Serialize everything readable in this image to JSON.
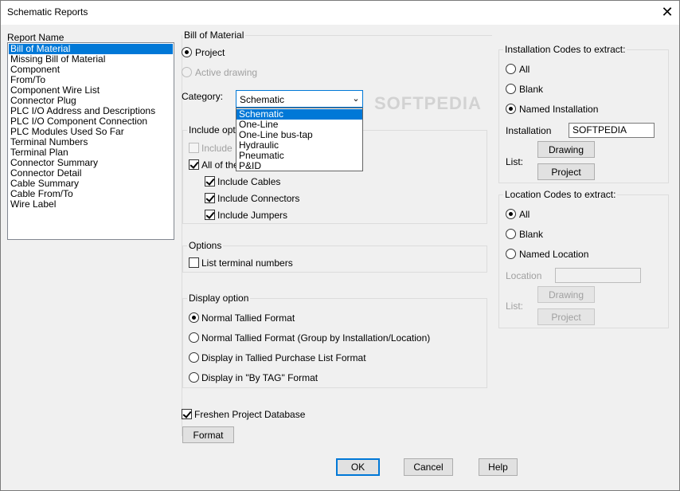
{
  "window": {
    "title": "Schematic Reports"
  },
  "report_list": {
    "label": "Report Name",
    "items": [
      "Bill of Material",
      "Missing Bill of Material",
      "Component",
      "From/To",
      "Component Wire List",
      "Connector Plug",
      "PLC I/O Address and Descriptions",
      "PLC I/O Component Connection",
      "PLC Modules Used So Far",
      "Terminal Numbers",
      "Terminal Plan",
      "Connector Summary",
      "Connector Detail",
      "Cable Summary",
      "Cable From/To",
      "Wire Label"
    ],
    "selected_index": 0
  },
  "bom": {
    "group_title": "Bill of Material",
    "project_label": "Project",
    "active_drawing_label": "Active drawing",
    "category_label": "Category:",
    "category_value": "Schematic",
    "category_options": [
      "Schematic",
      "One-Line",
      "One-Line bus-tap",
      "Hydraulic",
      "Pneumatic",
      "P&ID"
    ],
    "include_group_title": "Include optio",
    "include_inline_label": "Include In",
    "all_of_the_label": "All of the",
    "include_cables_label": "Include Cables",
    "include_connectors_label": "Include Connectors",
    "include_jumpers_label": "Include Jumpers"
  },
  "options": {
    "group_title": "Options",
    "list_terminal_label": "List terminal numbers"
  },
  "display": {
    "group_title": "Display option",
    "items": [
      "Normal Tallied Format",
      "Normal Tallied Format (Group by Installation/Location)",
      "Display in Tallied Purchase List Format",
      "Display in \"By TAG\" Format"
    ],
    "selected_index": 0
  },
  "freshen_label": "Freshen Project Database",
  "format_button": "Format",
  "installation": {
    "group_title": "Installation Codes to extract:",
    "all_label": "All",
    "blank_label": "Blank",
    "named_label": "Named Installation",
    "field_label": "Installation",
    "field_value": "SOFTPEDIA",
    "list_label": "List:",
    "drawing_button": "Drawing",
    "project_button": "Project"
  },
  "location": {
    "group_title": "Location Codes to extract:",
    "all_label": "All",
    "blank_label": "Blank",
    "named_label": "Named Location",
    "field_label": "Location",
    "field_value": "",
    "list_label": "List:",
    "drawing_button": "Drawing",
    "project_button": "Project"
  },
  "footer": {
    "ok": "OK",
    "cancel": "Cancel",
    "help": "Help"
  },
  "watermark": "SOFTPEDIA",
  "colors": {
    "selection": "#0078d7",
    "background": "#f0f0f0"
  }
}
